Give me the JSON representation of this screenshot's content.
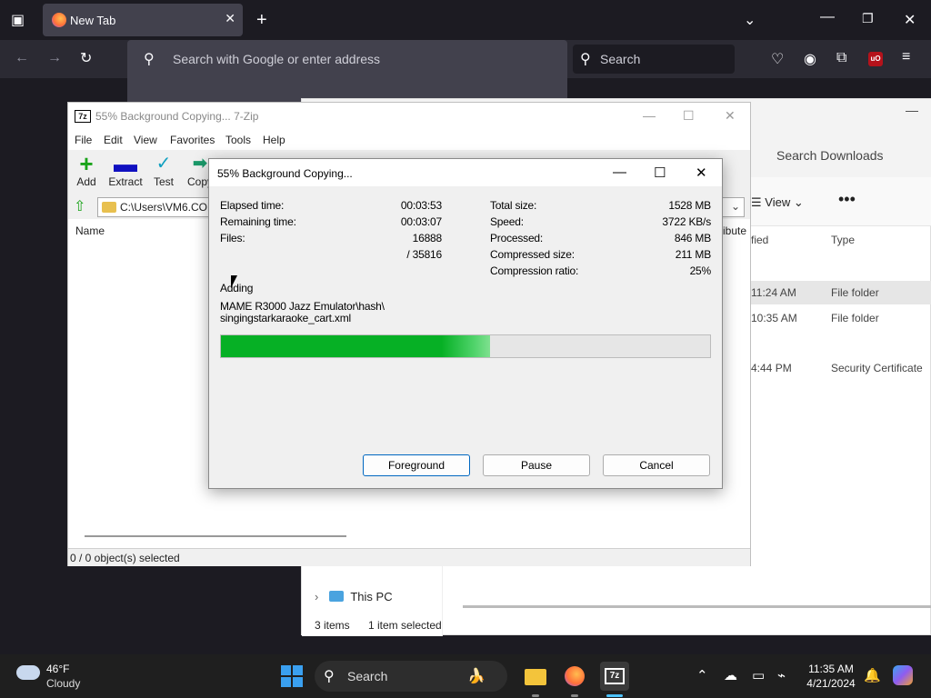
{
  "browser": {
    "tab_title": "New Tab",
    "url_placeholder": "Search with Google or enter address",
    "search_placeholder": "Search",
    "extension_badge": "uO"
  },
  "explorer": {
    "search_placeholder": "Search Downloads",
    "view_label": "View",
    "col_modified": "fied",
    "col_type": "Type",
    "rows": [
      {
        "date": "11:24 AM",
        "type": "File folder",
        "selected": true
      },
      {
        "date": "10:35 AM",
        "type": "File folder",
        "selected": false
      },
      {
        "date": "4:44 PM",
        "type": "Security Certificate",
        "selected": false
      }
    ],
    "nav_this_pc": "This PC",
    "status_items": "3 items",
    "status_selected": "1 item selected"
  },
  "sevenzip": {
    "title": "55% Background Copying... 7-Zip",
    "logo": "7z",
    "menu": [
      "File",
      "Edit",
      "View",
      "Favorites",
      "Tools",
      "Help"
    ],
    "toolbar": [
      "Add",
      "Extract",
      "Test",
      "Copy"
    ],
    "path": "C:\\Users\\VM6.COL",
    "col_name": "Name",
    "col_attributes": "ribute",
    "status": "0 / 0 object(s) selected"
  },
  "dialog": {
    "title": "55% Background Copying...",
    "left_labels": [
      "Elapsed time:",
      "Remaining time:",
      "Files:"
    ],
    "left_values": [
      "00:03:53",
      "00:03:07",
      "16888",
      "/ 35816"
    ],
    "right_labels": [
      "Total size:",
      "Speed:",
      "Processed:",
      "Compressed size:",
      "Compression ratio:"
    ],
    "right_values": [
      "1528 MB",
      "3722 KB/s",
      "846 MB",
      "211 MB",
      "25%"
    ],
    "action": "Adding",
    "current_file_line1": "MAME R3000 Jazz Emulator\\hash\\",
    "current_file_line2": "singingstarkaraoke_cart.xml",
    "progress": 0.55,
    "buttons": {
      "foreground": "Foreground",
      "pause": "Pause",
      "cancel": "Cancel"
    }
  },
  "taskbar": {
    "temperature": "46°F",
    "condition": "Cloudy",
    "search_placeholder": "Search",
    "time": "11:35 AM",
    "date": "4/21/2024"
  }
}
